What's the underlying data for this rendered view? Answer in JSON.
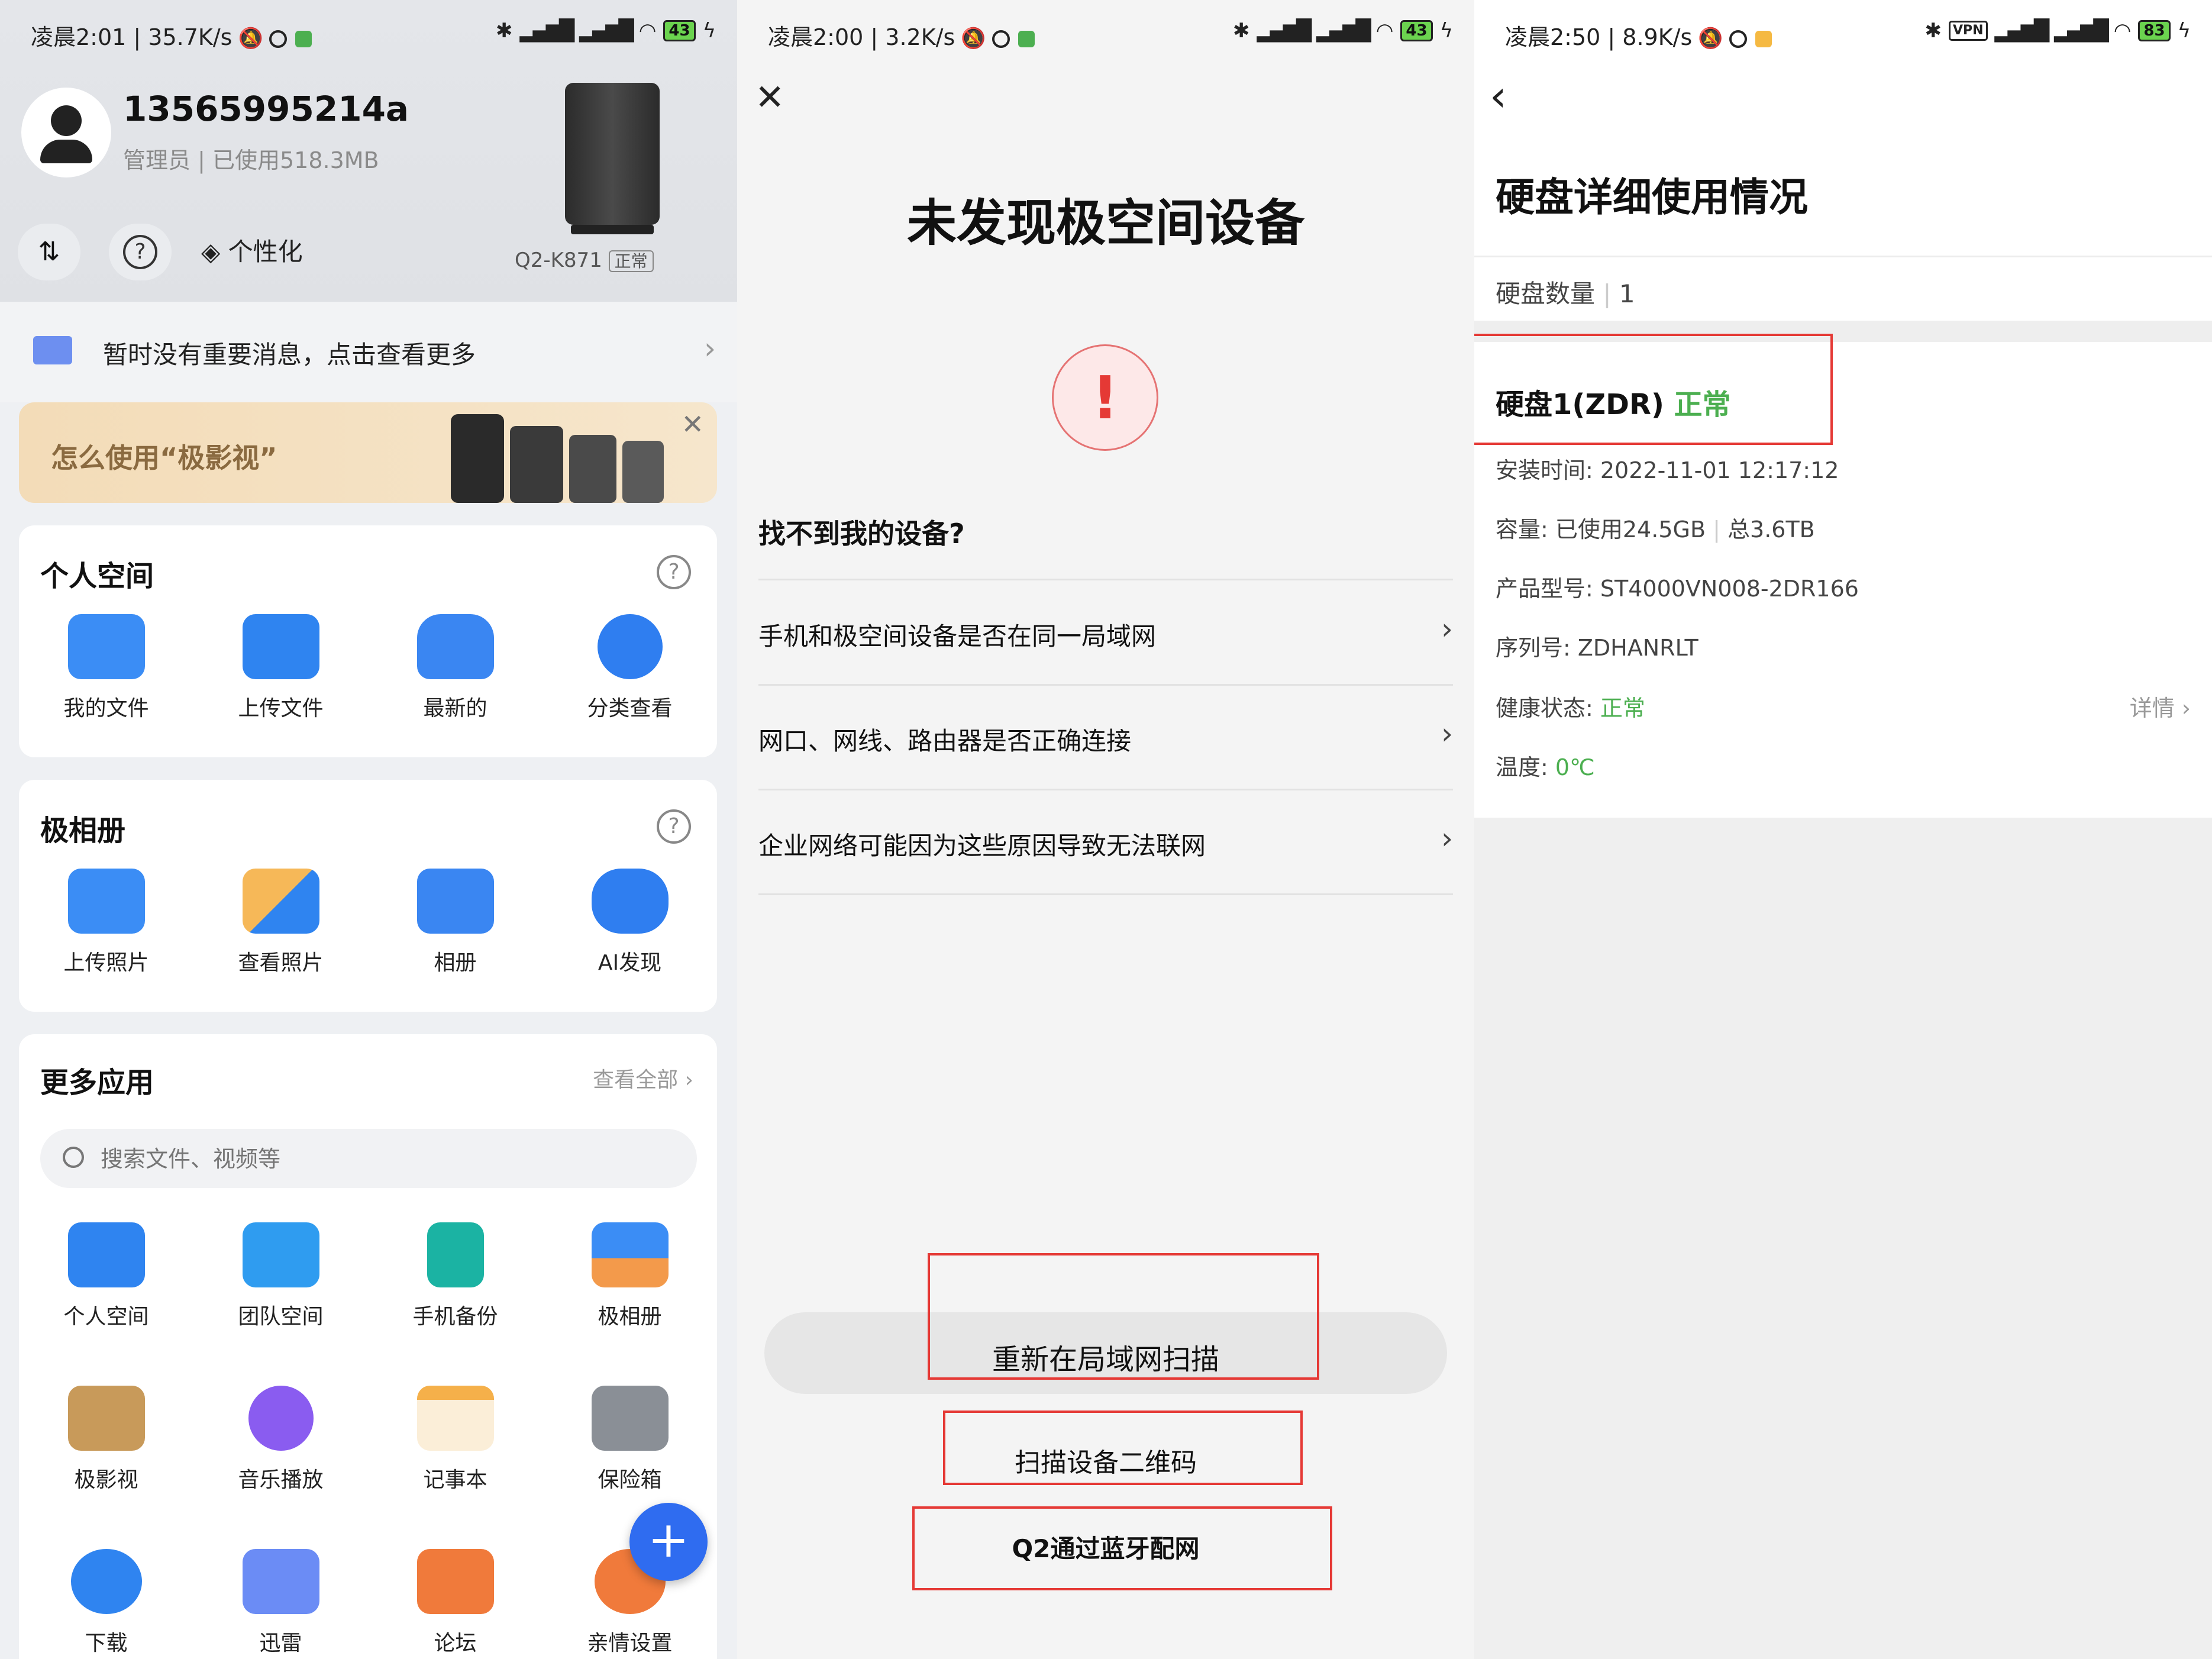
{
  "panel1": {
    "status": {
      "text": "凌晨2:01 | 35.7K/s",
      "battery": "43"
    },
    "profile": {
      "phone": "13565995214a",
      "meta": "管理员 | 已使用518.3MB",
      "device_model": "Q2-K871",
      "device_status": "正常"
    },
    "toolbar": {
      "personalize": "个性化"
    },
    "message": {
      "text": "暂时没有重要消息，点击查看更多"
    },
    "banner": {
      "text": "怎么使用“极影视”"
    },
    "personal_space": {
      "title": "个人空间",
      "items": [
        {
          "label": "我的文件",
          "color": "#3b8df5"
        },
        {
          "label": "上传文件",
          "color": "#2f84f0"
        },
        {
          "label": "最新的",
          "color": "#3a86f2"
        },
        {
          "label": "分类查看",
          "color": "#2f7ef0"
        }
      ]
    },
    "album": {
      "title": "极相册",
      "items": [
        {
          "label": "上传照片",
          "color": "#3b8df5"
        },
        {
          "label": "查看照片",
          "color": "#2f84f0"
        },
        {
          "label": "相册",
          "color": "#3a86f2"
        },
        {
          "label": "AI发现",
          "color": "#2f7ef0"
        }
      ]
    },
    "more_apps": {
      "title": "更多应用",
      "view_all": "查看全部",
      "search_placeholder": "搜索文件、视频等",
      "row1": [
        {
          "label": "个人空间",
          "color": "#2f84f0"
        },
        {
          "label": "团队空间",
          "color": "#2f9cf0"
        },
        {
          "label": "手机备份",
          "color": "#1bb3a3"
        },
        {
          "label": "极相册",
          "color": "#f39a4b"
        }
      ],
      "row2": [
        {
          "label": "极影视",
          "color": "#c89a5a"
        },
        {
          "label": "音乐播放",
          "color": "#8a5cf0"
        },
        {
          "label": "记事本",
          "color": "#f5b04a"
        },
        {
          "label": "保险箱",
          "color": "#8a8f96"
        }
      ],
      "row3": [
        {
          "label": "下载",
          "color": "#2f84f0"
        },
        {
          "label": "迅雷",
          "color": "#6b8cf5"
        },
        {
          "label": "论坛",
          "color": "#f07a3b"
        },
        {
          "label": "亲情设置",
          "color": "#f07a3b"
        }
      ]
    }
  },
  "panel2": {
    "status": {
      "text": "凌晨2:00 | 3.2K/s",
      "battery": "43"
    },
    "title": "未发现极空间设备",
    "question": "找不到我的设备?",
    "items": [
      "手机和极空间设备是否在同一局域网",
      "网口、网线、路由器是否正确连接",
      "企业网络可能因为这些原因导致无法联网"
    ],
    "buttons": {
      "rescan": "重新在局域网扫描",
      "scan_qr": "扫描设备二维码",
      "bluetooth": "Q2通过蓝牙配网"
    }
  },
  "panel3": {
    "status": {
      "text": "凌晨2:50 | 8.9K/s",
      "battery": "83",
      "vpn": "VPN"
    },
    "title": "硬盘详细使用情况",
    "count_label": "硬盘数量",
    "count_value": "1",
    "disk_name": "硬盘1(ZDR)",
    "disk_status": "正常",
    "install_time": "安装时间: 2022-11-01 12:17:12",
    "capacity_used": "容量: 已使用24.5GB",
    "capacity_total": "总3.6TB",
    "model": "产品型号: ST4000VN008-2DR166",
    "serial": "序列号: ZDHANRLT",
    "health_label": "健康状态:",
    "health_value": "正常",
    "details": "详情",
    "temp_label": "温度:",
    "temp_value": "0℃"
  }
}
